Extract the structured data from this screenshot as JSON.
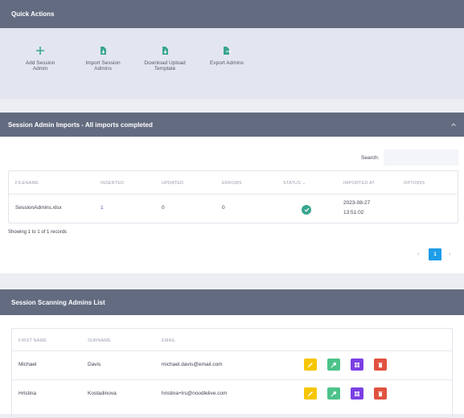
{
  "quick_actions": {
    "title": "Quick Actions",
    "items": [
      {
        "line1": "Add Session",
        "line2": "Admin",
        "icon": "plus-icon"
      },
      {
        "line1": "Import Session",
        "line2": "Admins",
        "icon": "file-import-icon"
      },
      {
        "line1": "Download Upload",
        "line2": "Template",
        "icon": "file-download-icon"
      },
      {
        "line1": "Export Admins",
        "line2": "",
        "icon": "file-export-icon"
      }
    ],
    "accent": "#3aa58f"
  },
  "imports": {
    "title": "Session Admin Imports - All imports completed",
    "collapse_glyph": "^",
    "search_label": "Search:",
    "search_value": "",
    "columns": [
      "Filename",
      "Inserted",
      "Updated",
      "Errors",
      "Status",
      "Imported At",
      "Options"
    ],
    "rows": [
      {
        "filename": "SessionAdmins.xlsx",
        "inserted": "1",
        "updated": "0",
        "errors": "0",
        "status": "completed",
        "imported_date": "2023-08-27",
        "imported_time": "13:51:02",
        "options": ""
      }
    ],
    "info": "Showing 1 to 1 of 1 records",
    "pagination": {
      "prev": "‹",
      "current": "1",
      "next": "›"
    }
  },
  "admins": {
    "title": "Session Scanning Admins List",
    "columns": [
      "First Name",
      "Surname",
      "Email"
    ],
    "rows": [
      {
        "first": "Michael",
        "surname": "Davis",
        "email": "michael.davis@email.com"
      },
      {
        "first": "Hristina",
        "surname": "Kostadinova",
        "email": "hristina+lrs@noodlelive.com"
      }
    ],
    "action_colors": {
      "edit": "#f7c600",
      "key": "#4cc38a",
      "grid": "#7b3fe4",
      "delete": "#e0523f"
    }
  },
  "colors": {
    "header_bg": "#636b80",
    "link": "#6a4bd0",
    "page_active": "#1e9de8"
  }
}
